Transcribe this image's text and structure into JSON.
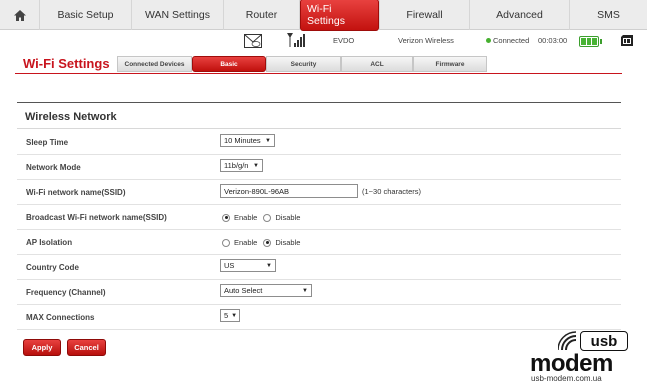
{
  "nav": {
    "home_icon": "home-icon",
    "tabs": [
      {
        "label": "Basic Setup"
      },
      {
        "label": "WAN Settings"
      },
      {
        "label": "Router"
      },
      {
        "label": "Wi-Fi Settings"
      },
      {
        "label": "Firewall"
      },
      {
        "label": "Advanced"
      },
      {
        "label": "SMS"
      }
    ],
    "active_tab": "Wi-Fi Settings"
  },
  "status": {
    "mail_icon": "mail-icon",
    "signal_icon": "signal-icon",
    "network_type": "EVDO",
    "carrier": "Verizon Wireless",
    "connection": "Connected",
    "timer": "00:03:00",
    "battery_icon": "battery-icon",
    "sim_icon": "sim-icon"
  },
  "page": {
    "title": "Wi-Fi Settings",
    "subtabs": [
      {
        "label": "Connected Devices"
      },
      {
        "label": "Basic"
      },
      {
        "label": "Security"
      },
      {
        "label": "ACL"
      },
      {
        "label": "Firmware"
      }
    ],
    "active_subtab": "Basic"
  },
  "section": {
    "title": "Wireless Network"
  },
  "fields": {
    "sleep_time": {
      "label": "Sleep Time",
      "value": "10 Minutes"
    },
    "network_mode": {
      "label": "Network Mode",
      "value": "11b/g/n"
    },
    "ssid": {
      "label": "Wi-Fi network name(SSID)",
      "value": "Verizon-890L-96AB",
      "hint": "(1~30 characters)"
    },
    "broadcast_ssid": {
      "label": "Broadcast Wi-Fi network name(SSID)",
      "options": [
        "Enable",
        "Disable"
      ],
      "selected": "Enable"
    },
    "ap_isolation": {
      "label": "AP Isolation",
      "options": [
        "Enable",
        "Disable"
      ],
      "selected": "Disable"
    },
    "country_code": {
      "label": "Country Code",
      "value": "US"
    },
    "frequency": {
      "label": "Frequency (Channel)",
      "value": "Auto Select"
    },
    "max_connections": {
      "label": "MAX Connections",
      "value": "5"
    }
  },
  "buttons": {
    "apply": "Apply",
    "cancel": "Cancel"
  },
  "watermark": {
    "usb": "usb",
    "brand": "modem",
    "url": "usb-modem.com.ua"
  }
}
